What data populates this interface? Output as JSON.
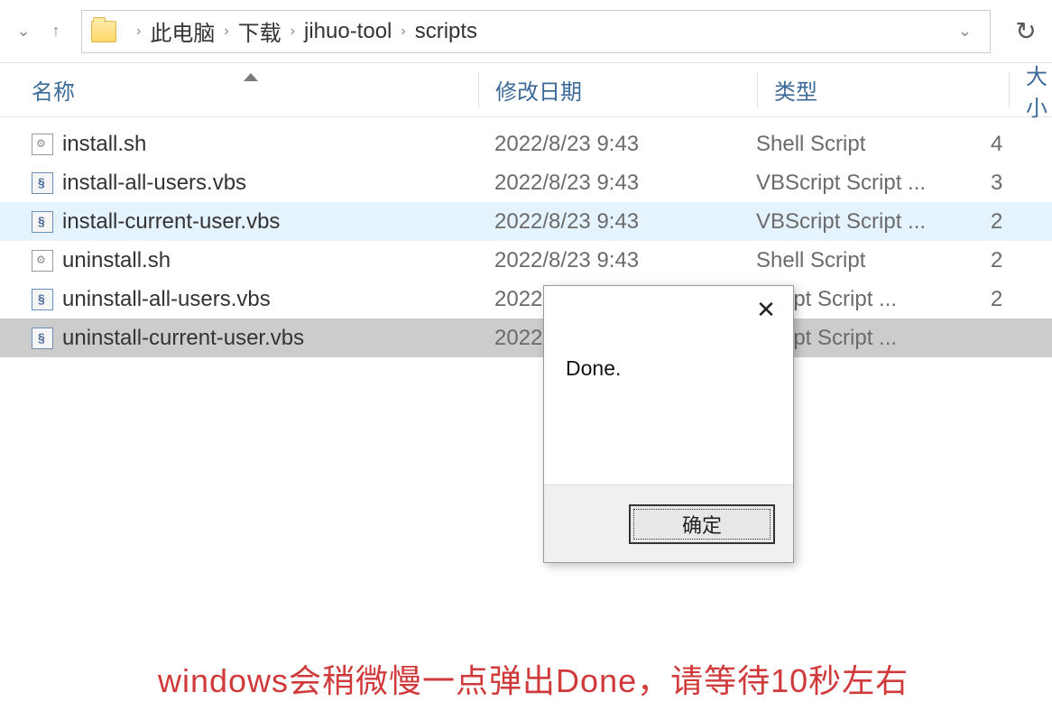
{
  "breadcrumb": {
    "items": [
      "此电脑",
      "下载",
      "jihuo-tool",
      "scripts"
    ]
  },
  "columns": {
    "name": "名称",
    "date": "修改日期",
    "type": "类型",
    "size": "大小"
  },
  "files": [
    {
      "name": "install.sh",
      "date": "2022/8/23 9:43",
      "type": "Shell Script",
      "size": "4",
      "icon": "sh",
      "state": ""
    },
    {
      "name": "install-all-users.vbs",
      "date": "2022/8/23 9:43",
      "type": "VBScript Script ...",
      "size": "3",
      "icon": "vbs",
      "state": ""
    },
    {
      "name": "install-current-user.vbs",
      "date": "2022/8/23 9:43",
      "type": "VBScript Script ...",
      "size": "2",
      "icon": "vbs",
      "state": "highlighted"
    },
    {
      "name": "uninstall.sh",
      "date": "2022/8/23 9:43",
      "type": "Shell Script",
      "size": "2",
      "icon": "sh",
      "state": ""
    },
    {
      "name": "uninstall-all-users.vbs",
      "date": "2022",
      "type": "Script Script ...",
      "size": "2",
      "icon": "vbs",
      "state": ""
    },
    {
      "name": "uninstall-current-user.vbs",
      "date": "2022",
      "type": "Script Script ...",
      "size": "",
      "icon": "vbs",
      "state": "selected"
    }
  ],
  "dialog": {
    "message": "Done.",
    "ok": "确定"
  },
  "annotation": "windows会稍微慢一点弹出Done，请等待10秒左右"
}
